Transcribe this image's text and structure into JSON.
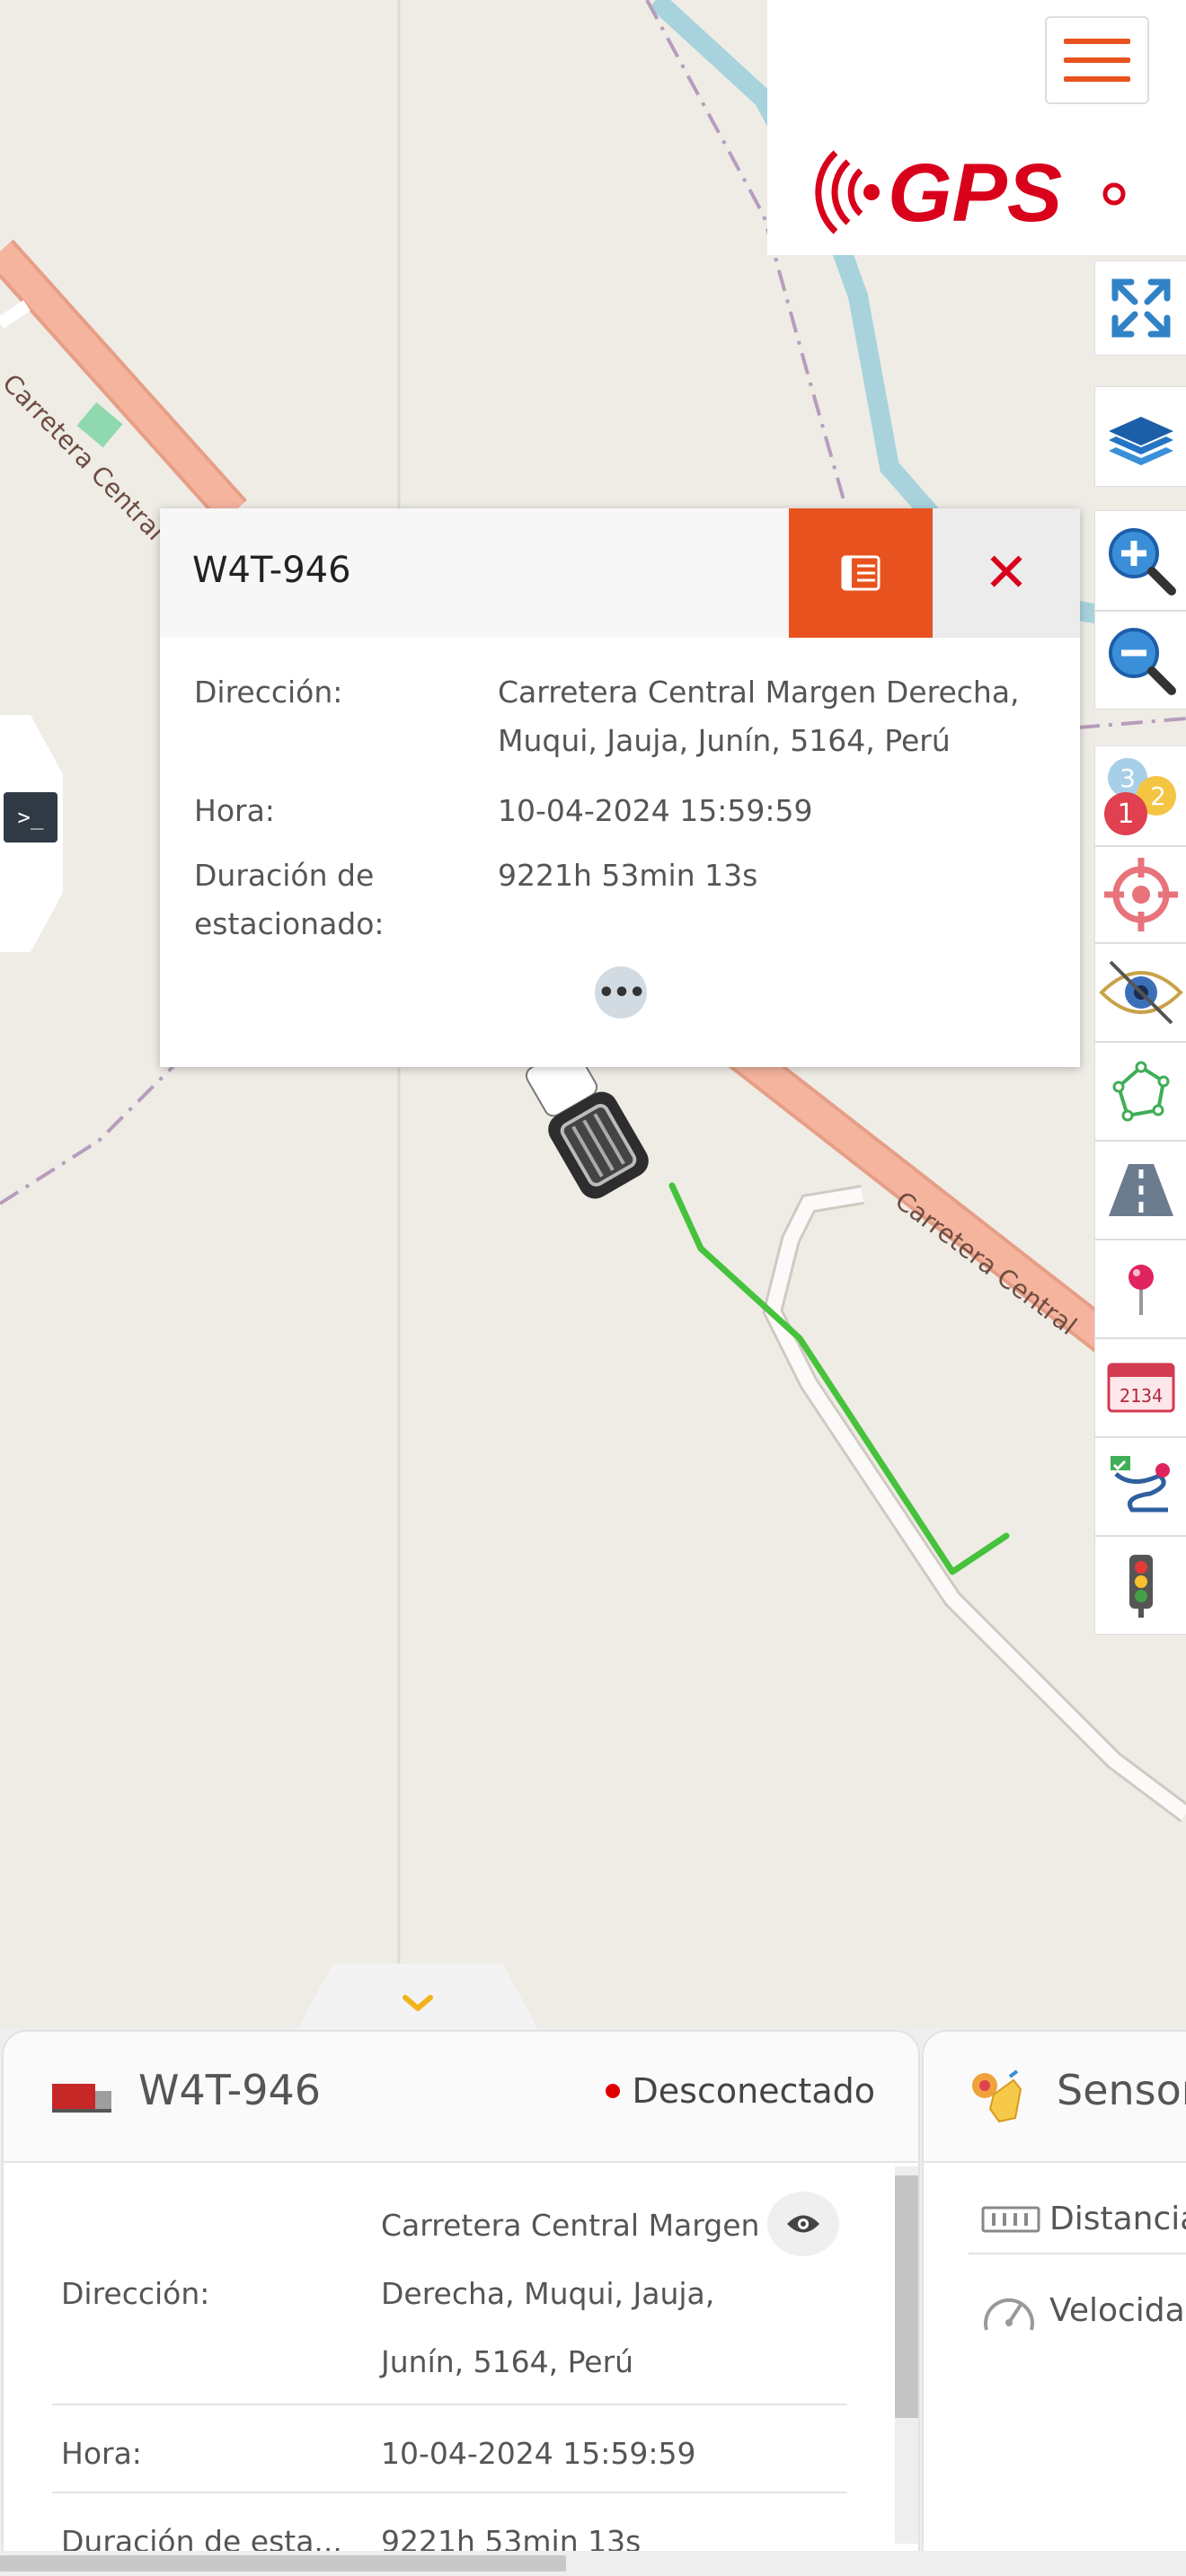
{
  "map": {
    "road_labels": [
      "Carretera Central M",
      "Carretera Central"
    ]
  },
  "header": {
    "logo_text": "GPS",
    "menu_icon": "hamburger-icon"
  },
  "toolbar": {
    "tools": [
      "fullscreen-icon",
      "layers-icon",
      "zoom-in-icon",
      "zoom-out-icon",
      "cluster-icon",
      "locate-target-icon",
      "visibility-eye-icon",
      "geofence-polygon-icon",
      "route-road-icon",
      "poi-pin-icon",
      "license-plate-icon",
      "route-history-icon",
      "traffic-light-icon"
    ],
    "cluster_numbers": [
      "3",
      "2",
      "1"
    ],
    "plate_number": "2134"
  },
  "left_tab": {
    "terminal_label": ">_"
  },
  "popup": {
    "title": "W4T-946",
    "fields": [
      {
        "label": "Dirección:",
        "value": "Carretera Central Margen Derecha, Muqui, Jauja, Junín, 5164, Perú"
      },
      {
        "label": "Hora:",
        "value": "10-04-2024 15:59:59"
      },
      {
        "label": "Duración de estacionado:",
        "value": "9221h 53min 13s"
      }
    ],
    "more": "•••",
    "close": "✕"
  },
  "vehicle_card": {
    "name": "W4T-946",
    "status": "Desconectado",
    "status_color": "#e00000",
    "rows": [
      {
        "label": "Dirección:",
        "value": "Carretera Central Margen Derecha, Muqui, Jauja, Junín, 5164, Perú"
      },
      {
        "label": "Hora:",
        "value": "10-04-2024 15:59:59"
      },
      {
        "label": "Duración de esta...",
        "value": "9221h 53min 13s"
      }
    ]
  },
  "sensor_card": {
    "title": "Sensor",
    "rows": [
      {
        "icon": "odometer-icon",
        "label": "Distancia"
      },
      {
        "icon": "speedometer-icon",
        "label": "Velocida"
      }
    ]
  },
  "colors": {
    "accent": "#e8521e",
    "road": "#f2a98e",
    "route": "#3ec33a",
    "river": "#a8d3dd"
  }
}
